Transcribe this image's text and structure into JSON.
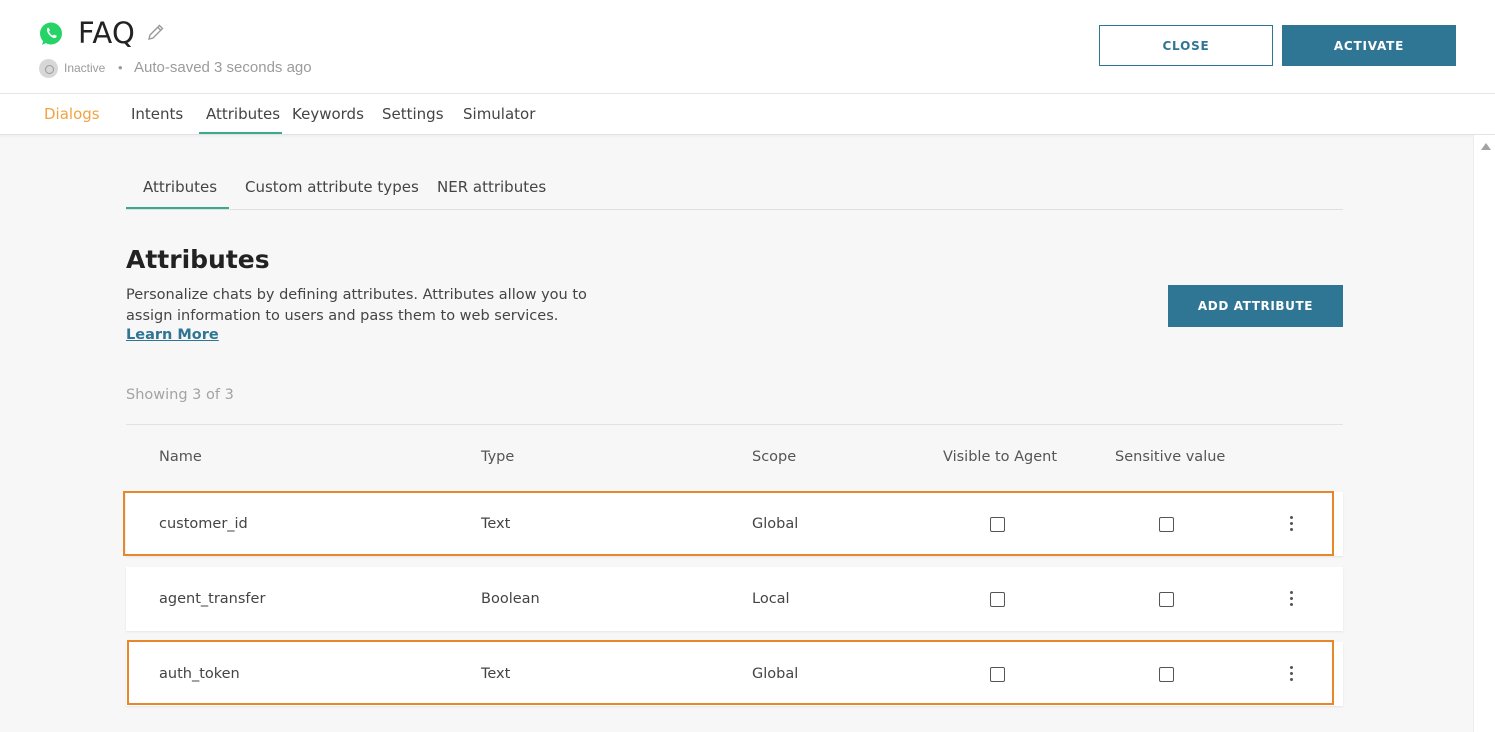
{
  "header": {
    "title": "FAQ",
    "status": "Inactive",
    "bullet": "•",
    "autosave": "Auto-saved 3 seconds ago",
    "close_label": "CLOSE",
    "activate_label": "ACTIVATE",
    "channel_icon": "whatsapp-icon",
    "edit_icon": "pencil-icon"
  },
  "nav": {
    "items": [
      "Dialogs",
      "Intents",
      "Attributes",
      "Keywords",
      "Settings",
      "Simulator"
    ],
    "active": "Attributes"
  },
  "subtabs": {
    "items": [
      "Attributes",
      "Custom attribute types",
      "NER attributes"
    ],
    "active": "Attributes"
  },
  "main": {
    "title": "Attributes",
    "description": "Personalize chats by defining attributes. Attributes allow you to assign information to users and pass them to web services.",
    "learn_more": "Learn More",
    "add_label": "ADD ATTRIBUTE",
    "showing": "Showing 3 of 3"
  },
  "table": {
    "columns": [
      "Name",
      "Type",
      "Scope",
      "Visible to Agent",
      "Sensitive value"
    ],
    "rows": [
      {
        "name": "customer_id",
        "type": "Text",
        "scope": "Global",
        "visible": false,
        "sensitive": false
      },
      {
        "name": "agent_transfer",
        "type": "Boolean",
        "scope": "Local",
        "visible": false,
        "sensitive": false
      },
      {
        "name": "auth_token",
        "type": "Text",
        "scope": "Global",
        "visible": false,
        "sensitive": false
      }
    ]
  },
  "colors": {
    "accent": "#2f7594",
    "tab_underline": "#3aa98e",
    "dialogs_tab": "#f0a341",
    "highlight": "#e8862a"
  }
}
